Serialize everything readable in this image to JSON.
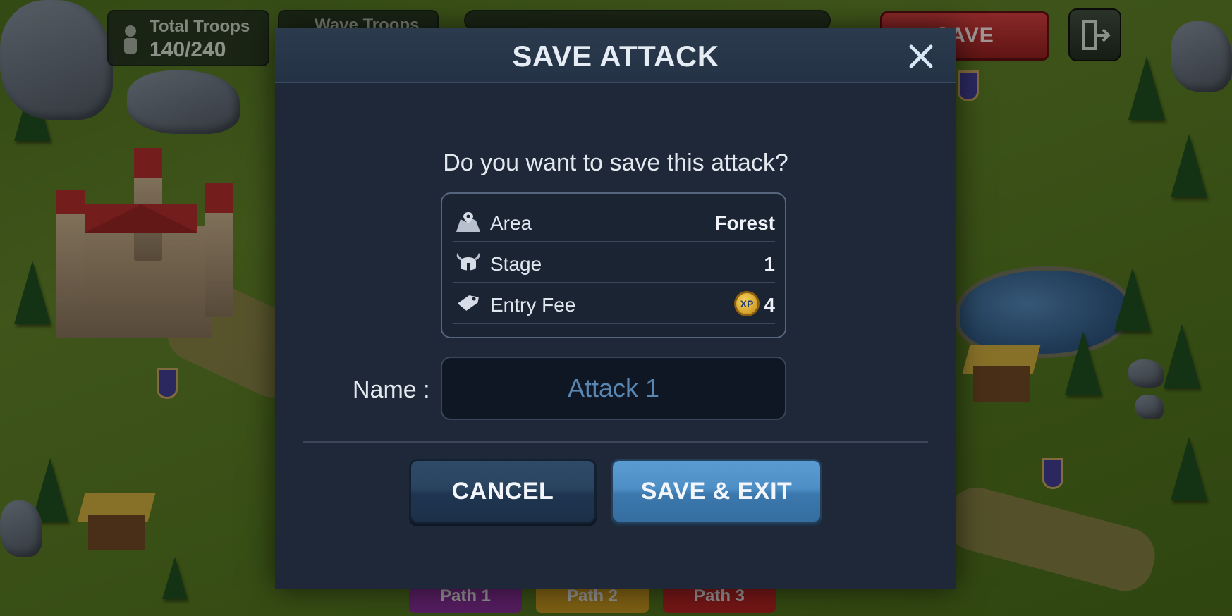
{
  "hud": {
    "total_troops_label": "Total Troops",
    "total_troops_value": "140/240",
    "wave_troops_label": "Wave Troops",
    "save_label": "SAVE",
    "paths": [
      "Path 1",
      "Path 2",
      "Path 3"
    ]
  },
  "dialog": {
    "title": "SAVE ATTACK",
    "question": "Do you want to save this attack?",
    "info": [
      {
        "icon": "map-pin-icon",
        "label": "Area",
        "value": "Forest"
      },
      {
        "icon": "viking-helmet-icon",
        "label": "Stage",
        "value": "1"
      },
      {
        "icon": "price-tag-icon",
        "label": "Entry Fee",
        "value": "4",
        "currency": "XP"
      }
    ],
    "name_label": "Name :",
    "name_value": "Attack 1",
    "cancel_label": "CANCEL",
    "save_exit_label": "SAVE & EXIT"
  },
  "colors": {
    "dialog_bg": "#1e2838",
    "cancel_button": "#2a4460",
    "save_button": "#4e8fc6",
    "input_text": "#5a86b2"
  }
}
